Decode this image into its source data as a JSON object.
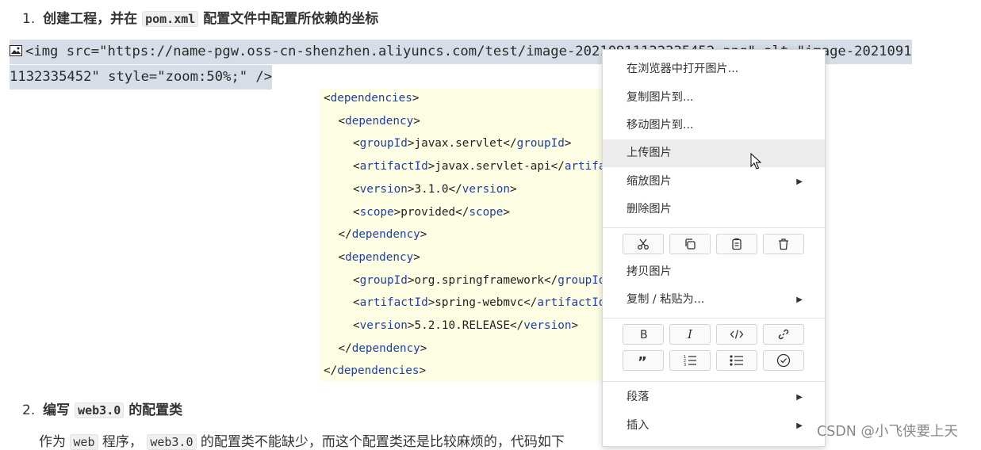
{
  "heading1": {
    "num": "1.",
    "pre": "创建工程，并在",
    "code": "pom.xml",
    "post": "配置文件中配置所依赖的坐标"
  },
  "img_source": {
    "line1": "<img src=\"https://name-pgw.oss-cn-shenzhen.aliyuncs.com/test/image-20210911132335452.png\" alt=\"image-2021091",
    "line2": "1132335452\" style=\"zoom:50%;\" />"
  },
  "code_image": {
    "lines": [
      {
        "indent": 0,
        "open": "dependencies",
        "text": "",
        "close": ""
      },
      {
        "indent": 1,
        "open": "dependency",
        "text": "",
        "close": ""
      },
      {
        "indent": 2,
        "open": "groupId",
        "text": "javax.servlet",
        "close": "groupId"
      },
      {
        "indent": 2,
        "open": "artifactId",
        "text": "javax.servlet-api",
        "close": "artifactId"
      },
      {
        "indent": 2,
        "open": "version",
        "text": "3.1.0",
        "close": "version"
      },
      {
        "indent": 2,
        "open": "scope",
        "text": "provided",
        "close": "scope"
      },
      {
        "indent": 1,
        "open": "",
        "text": "",
        "close": "dependency"
      },
      {
        "indent": 1,
        "open": "dependency",
        "text": "",
        "close": ""
      },
      {
        "indent": 2,
        "open": "groupId",
        "text": "org.springframework",
        "close": "groupId"
      },
      {
        "indent": 2,
        "open": "artifactId",
        "text": "spring-webmvc",
        "close": "artifactId"
      },
      {
        "indent": 2,
        "open": "version",
        "text": "5.2.10.RELEASE",
        "close": "version"
      },
      {
        "indent": 1,
        "open": "",
        "text": "",
        "close": "dependency"
      },
      {
        "indent": 0,
        "open": "",
        "text": "",
        "close": "dependencies"
      }
    ]
  },
  "heading2": {
    "num": "2.",
    "pre": "编写",
    "code": "web3.0",
    "post": "的配置类"
  },
  "paragraph": {
    "p1": "作为",
    "c1": "web",
    "p2": "程序，",
    "c2": "web3.0",
    "p3": "的配置类不能缺少，而这个配置类还是比较麻烦的，代码如下"
  },
  "context_menu": {
    "items": [
      {
        "label": "在浏览器中打开图片...",
        "submenu": false
      },
      {
        "label": "复制图片到...",
        "submenu": false
      },
      {
        "label": "移动图片到...",
        "submenu": false
      },
      {
        "label": "上传图片",
        "submenu": false,
        "hovered": true
      },
      {
        "label": "缩放图片",
        "submenu": true
      },
      {
        "label": "删除图片",
        "submenu": false
      }
    ],
    "edit_icons": [
      "cut-icon",
      "copy-icon",
      "paste-icon",
      "delete-icon"
    ],
    "items2": [
      {
        "label": "拷贝图片",
        "submenu": false
      },
      {
        "label": "复制 / 粘贴为...",
        "submenu": true
      }
    ],
    "format_icons_row1": [
      "bold-icon",
      "italic-icon",
      "code-icon",
      "link-icon"
    ],
    "format_icons_row2": [
      "quote-icon",
      "ordered-list-icon",
      "bullet-list-icon",
      "task-list-icon"
    ],
    "items3": [
      {
        "label": "段落",
        "submenu": true
      },
      {
        "label": "插入",
        "submenu": true
      }
    ],
    "arrow_glyph": "▶"
  },
  "watermark": "CSDN @小飞侠要上天",
  "colors": {
    "selection": "#d6dde6",
    "code_bg": "#fdfde4",
    "tag_blue": "#1f3fa8",
    "menu_hover": "#ececec"
  }
}
